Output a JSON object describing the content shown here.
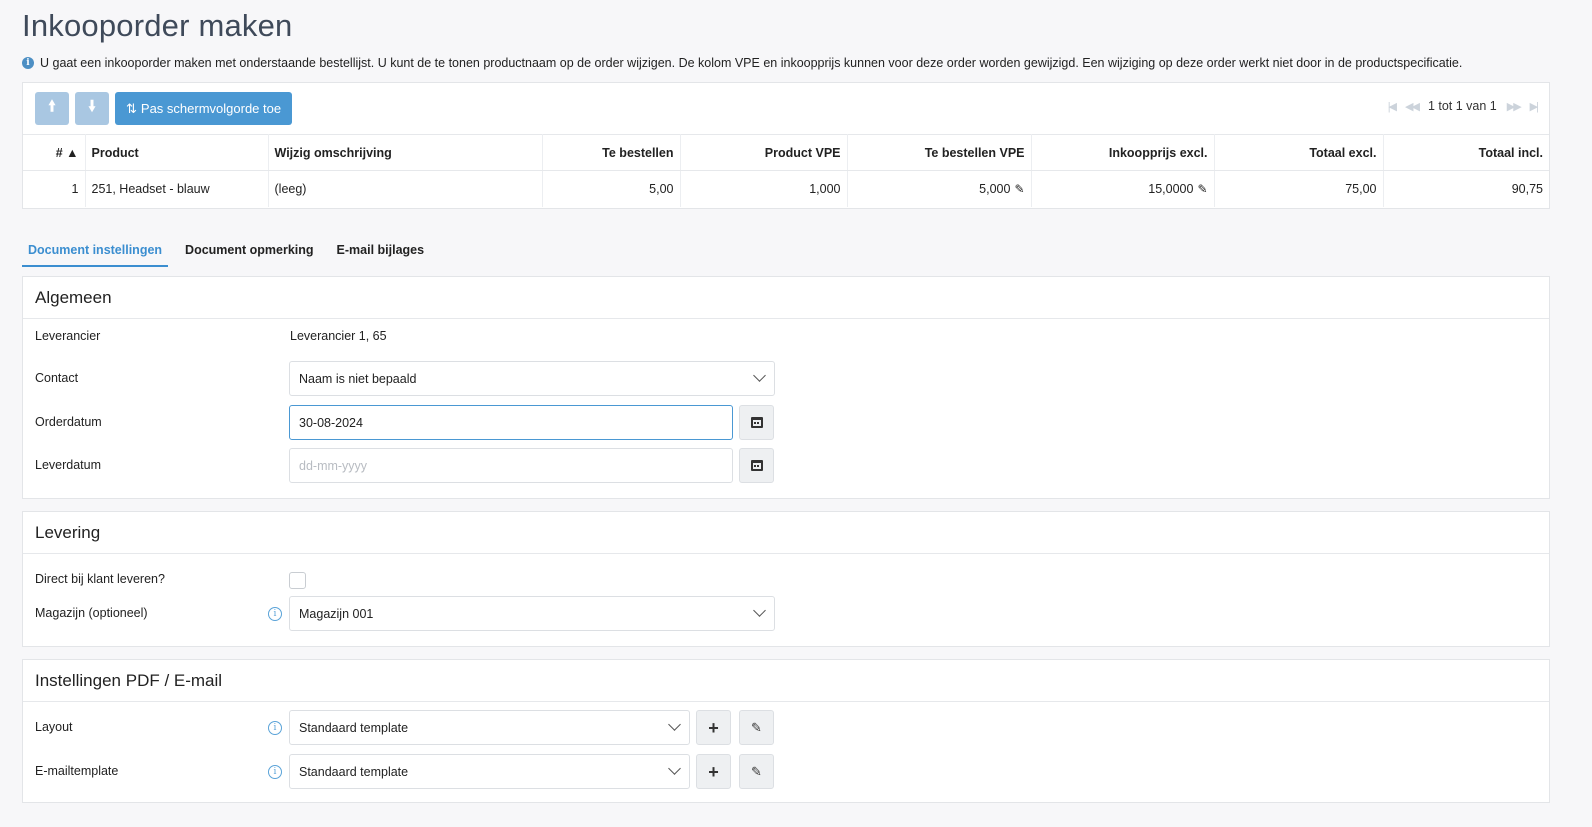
{
  "page": {
    "title": "Inkooporder maken",
    "info": "U gaat een inkooporder maken met onderstaande bestellijst. U kunt de te tonen productnaam op de order wijzigen. De kolom VPE en inkoopprijs kunnen voor deze order worden gewijzigd. Een wijziging op deze order werkt niet door in de productspecificatie."
  },
  "toolbar": {
    "up_icon": "arrow-up-icon",
    "down_icon": "arrow-down-icon",
    "apply_label": "Pas schermvolgorde toe"
  },
  "pager": {
    "text": "1 tot 1 van 1"
  },
  "table": {
    "headers": {
      "num": "#",
      "product": "Product",
      "desc": "Wijzig omschrijving",
      "order_qty": "Te bestellen",
      "product_vpe": "Product VPE",
      "order_vpe": "Te bestellen VPE",
      "price": "Inkoopprijs excl.",
      "total_excl": "Totaal excl.",
      "total_incl": "Totaal incl."
    },
    "rows": [
      {
        "num": "1",
        "product": "251, Headset - blauw",
        "desc": "(leeg)",
        "order_qty": "5,00",
        "product_vpe": "1,000",
        "order_vpe": "5,000",
        "price": "15,0000",
        "total_excl": "75,00",
        "total_incl": "90,75"
      }
    ]
  },
  "tabs": [
    {
      "label": "Document instellingen",
      "active": true
    },
    {
      "label": "Document opmerking",
      "active": false
    },
    {
      "label": "E-mail bijlages",
      "active": false
    }
  ],
  "general": {
    "heading": "Algemeen",
    "supplier_label": "Leverancier",
    "supplier_value": "Leverancier 1, 65",
    "contact_label": "Contact",
    "contact_value": "Naam is niet bepaald",
    "orderdate_label": "Orderdatum",
    "orderdate_value": "30-08-2024",
    "deliverydate_label": "Leverdatum",
    "deliverydate_placeholder": "dd-mm-yyyy"
  },
  "delivery": {
    "heading": "Levering",
    "direct_label": "Direct bij klant leveren?",
    "direct_checked": false,
    "warehouse_label": "Magazijn (optioneel)",
    "warehouse_value": "Magazijn 001"
  },
  "pdf": {
    "heading": "Instellingen PDF / E-mail",
    "layout_label": "Layout",
    "layout_value": "Standaard template",
    "email_label": "E-mailtemplate",
    "email_value": "Standaard template"
  },
  "colors": {
    "primary": "#4a98d3",
    "primary_disabled": "#a9c7e2",
    "title": "#3f4a5a",
    "tab_active": "#3b8ed0"
  }
}
